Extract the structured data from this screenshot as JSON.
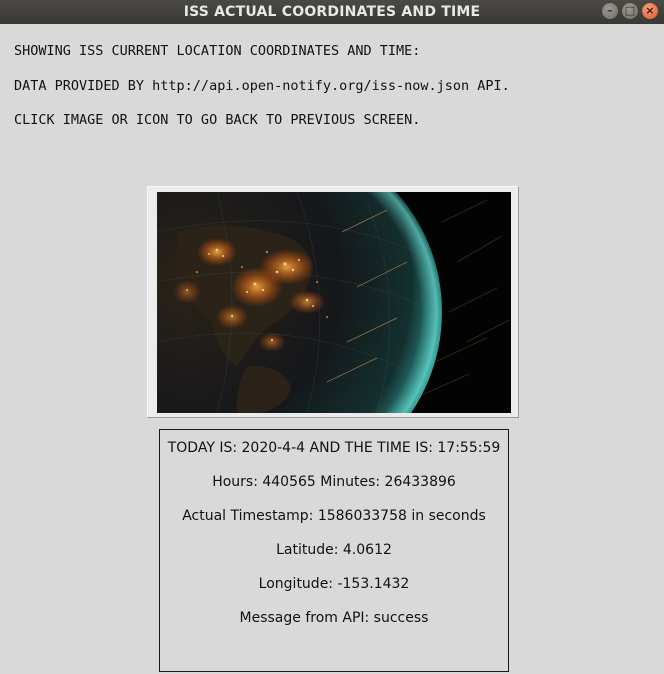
{
  "window": {
    "title": "ISS ACTUAL COORDINATES AND TIME",
    "controls": [
      "minimize",
      "maximize",
      "close"
    ]
  },
  "instructions": {
    "line1": "SHOWING ISS CURRENT LOCATION COORDINATES AND TIME:",
    "line2": "DATA PROVIDED BY http://api.open-notify.org/iss-now.json API.",
    "line3": "CLICK IMAGE OR ICON TO GO BACK TO PREVIOUS SCREEN."
  },
  "image": {
    "icon": "earth-at-night-image"
  },
  "data": {
    "today": "TODAY IS: 2020-4-4 AND THE TIME IS: 17:55:59",
    "hours_minutes": "Hours: 440565 Minutes: 26433896",
    "timestamp": "Actual Timestamp: 1586033758 in seconds",
    "latitude": "Latitude: 4.0612",
    "longitude": "Longitude: -153.1432",
    "message": "Message from API: success"
  },
  "colors": {
    "background": "#d9d9d9",
    "titlebar": "#3c3b37",
    "close_button": "#e0562a",
    "city_lights": "#ff9a2e",
    "atmosphere": "#4fd1c5"
  }
}
